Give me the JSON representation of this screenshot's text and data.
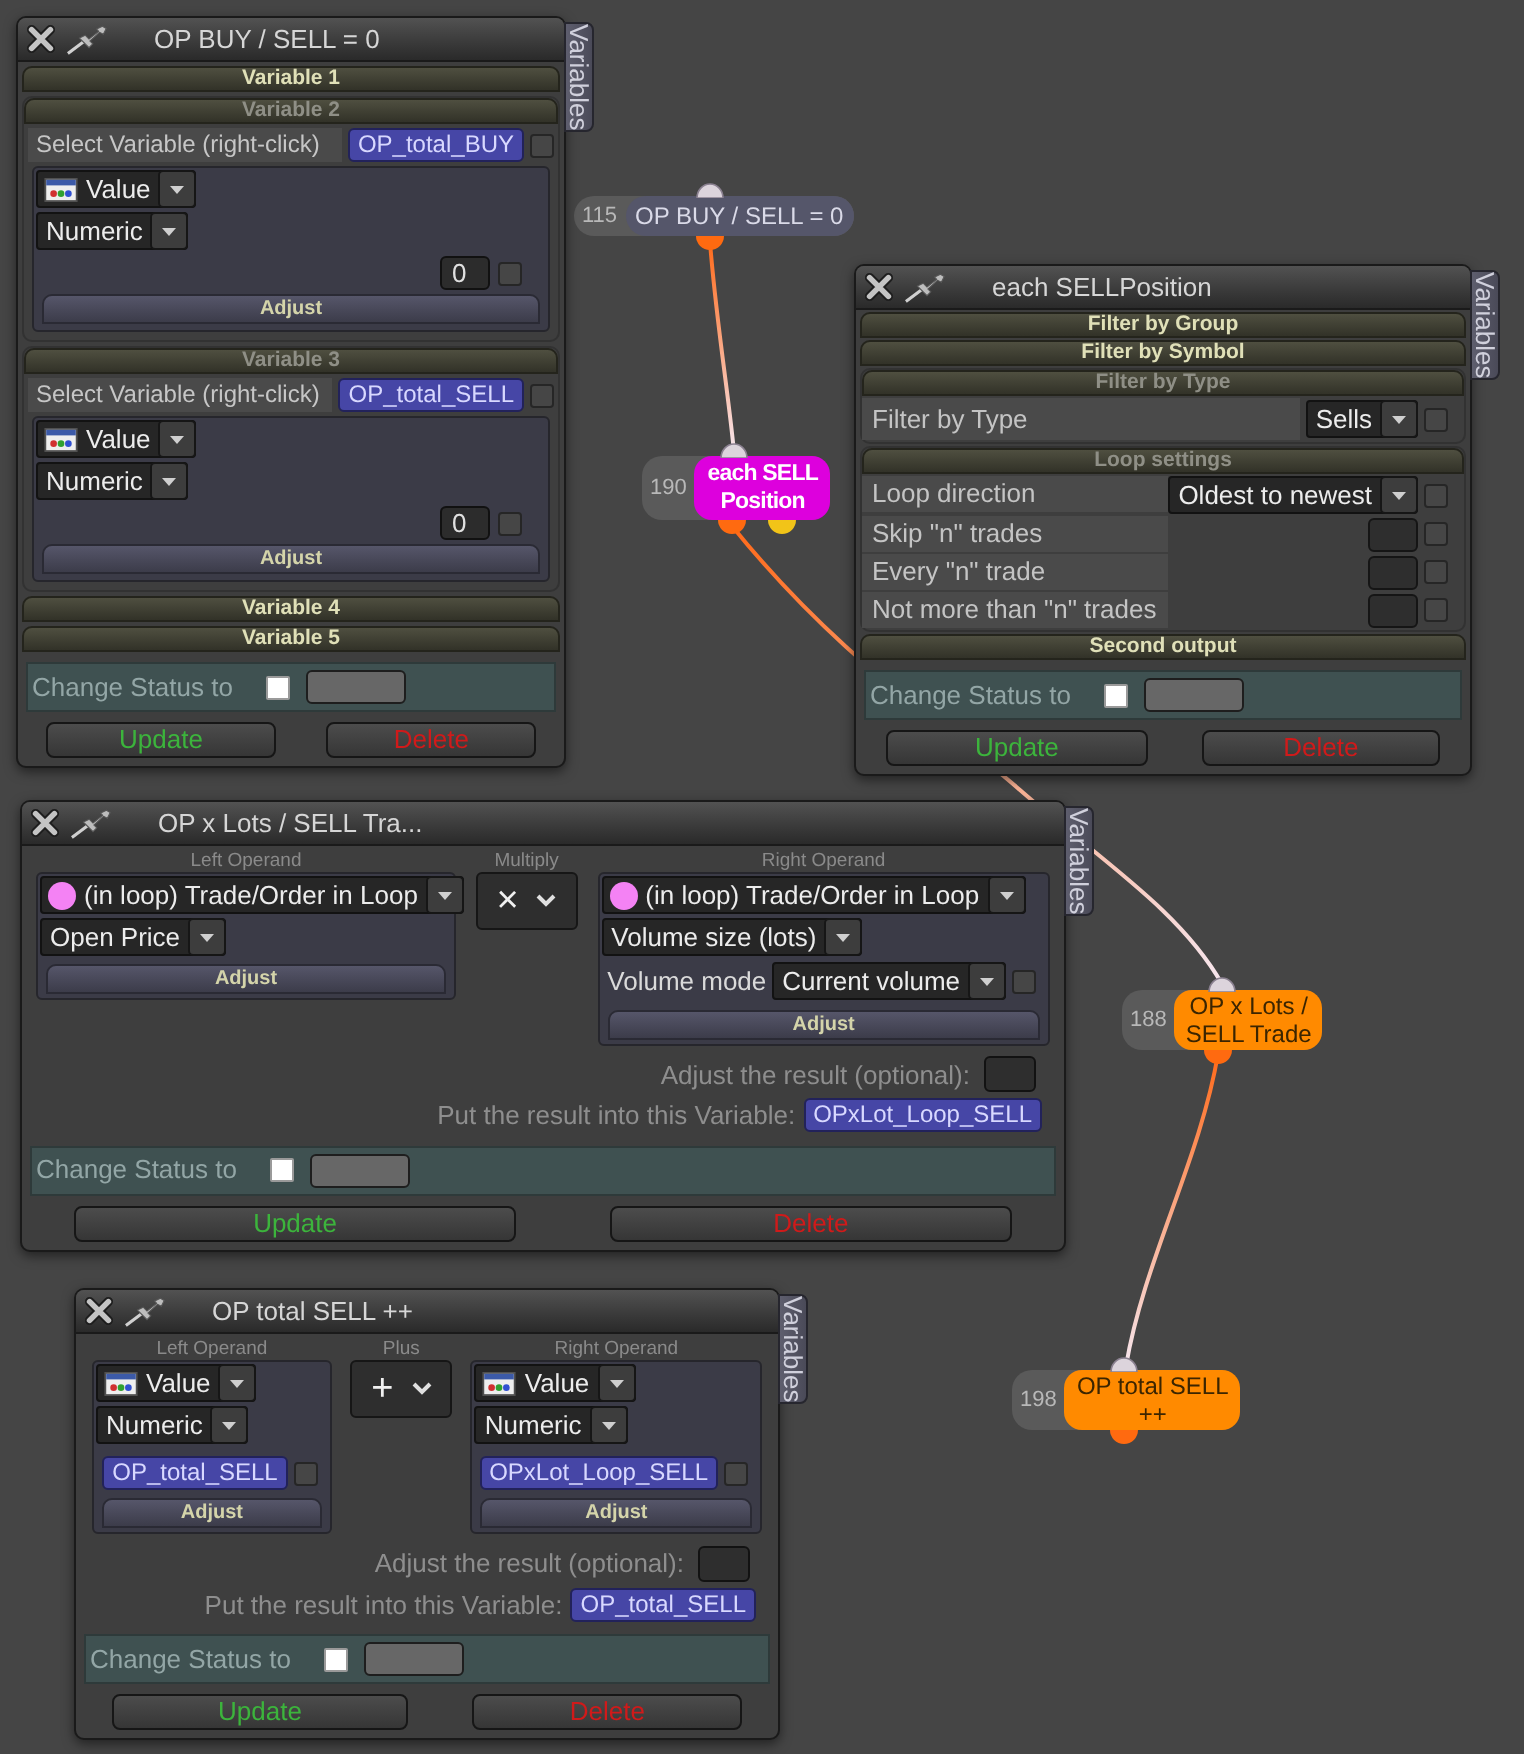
{
  "panels": [
    {
      "kind": "variables",
      "title": "OP BUY / SELL = 0",
      "side_tab": "Variables",
      "sections": [
        {
          "title": "Variable 1",
          "expanded": false
        },
        {
          "title": "Variable 2",
          "expanded": true,
          "select_label": "Select Variable (right-click)",
          "variable": {
            "name": "OP_total_BUY",
            "checked": false
          },
          "source": "Value",
          "format": "Numeric",
          "value": {
            "text": "0",
            "checked": false
          },
          "adjust": "Adjust"
        },
        {
          "title": "Variable 3",
          "expanded": true,
          "select_label": "Select Variable (right-click)",
          "variable": {
            "name": "OP_total_SELL",
            "checked": false
          },
          "source": "Value",
          "format": "Numeric",
          "value": {
            "text": "0",
            "checked": false
          },
          "adjust": "Adjust"
        },
        {
          "title": "Variable 4",
          "expanded": false
        },
        {
          "title": "Variable 5",
          "expanded": false
        }
      ],
      "status": {
        "label": "Change Status to",
        "checked": false
      },
      "buttons": [
        {
          "kind": "update",
          "label": "Update"
        },
        {
          "kind": "delete",
          "label": "Delete"
        }
      ]
    },
    {
      "kind": "loop",
      "title": "each SELLPosition",
      "side_tab": "Variables",
      "sections": [
        {
          "title": "Filter by Group",
          "expanded": false
        },
        {
          "title": "Filter by Symbol",
          "expanded": false
        },
        {
          "title": "Filter by Type",
          "expanded": true,
          "rows": [
            {
              "kind": "select",
              "label": "Filter by Type",
              "value": "Sells",
              "checked": false
            }
          ]
        },
        {
          "title": "Loop settings",
          "expanded": true,
          "rows": [
            {
              "kind": "select",
              "label": "Loop direction",
              "value": "Oldest to newest",
              "checked": false
            },
            {
              "kind": "input",
              "label": "Skip \"n\" trades",
              "checked": false
            },
            {
              "kind": "input",
              "label": "Every \"n\" trade",
              "checked": false
            },
            {
              "kind": "input",
              "label": "Not more than \"n\" trades",
              "checked": false
            }
          ]
        },
        {
          "title": "Second output",
          "expanded": false
        }
      ],
      "status": {
        "label": "Change Status to",
        "checked": false
      },
      "buttons": [
        {
          "kind": "update",
          "label": "Update"
        },
        {
          "kind": "delete",
          "label": "Delete"
        }
      ]
    },
    {
      "kind": "operation",
      "title": "OP x Lots / SELL Tra...",
      "side_tab": "Variables",
      "left": {
        "label": "Left Operand",
        "rows": [
          {
            "kind": "loop-source",
            "value": "(in loop) Trade/Order in Loop"
          },
          {
            "kind": "select",
            "value": "Open Price"
          },
          {
            "kind": "adjust",
            "label": "Adjust"
          }
        ]
      },
      "operator": {
        "label": "Multiply",
        "symbol": "×"
      },
      "right": {
        "label": "Right Operand",
        "rows": [
          {
            "kind": "loop-source",
            "value": "(in loop) Trade/Order in Loop"
          },
          {
            "kind": "select",
            "value": "Volume size (lots)"
          },
          {
            "kind": "labeled-select",
            "label": "Volume mode",
            "value": "Current volume",
            "checked": false
          },
          {
            "kind": "adjust",
            "label": "Adjust"
          }
        ]
      },
      "result": {
        "adjust_label": "Adjust the result (optional):",
        "target_label": "Put the result into this Variable:",
        "target": "OPxLot_Loop_SELL"
      },
      "status": {
        "label": "Change Status to",
        "checked": false
      },
      "buttons": [
        {
          "kind": "update",
          "label": "Update"
        },
        {
          "kind": "delete",
          "label": "Delete"
        }
      ]
    },
    {
      "kind": "operation",
      "title": "OP total SELL ++",
      "side_tab": "Variables",
      "left": {
        "label": "Left Operand",
        "rows": [
          {
            "kind": "value-source",
            "value": "Value"
          },
          {
            "kind": "select",
            "value": "Numeric"
          },
          {
            "kind": "variable",
            "value": "OP_total_SELL",
            "checked": false
          },
          {
            "kind": "adjust",
            "label": "Adjust"
          }
        ]
      },
      "operator": {
        "label": "Plus",
        "symbol": "+"
      },
      "right": {
        "label": "Right Operand",
        "rows": [
          {
            "kind": "value-source",
            "value": "Value"
          },
          {
            "kind": "select",
            "value": "Numeric"
          },
          {
            "kind": "variable",
            "value": "OPxLot_Loop_SELL",
            "checked": false
          },
          {
            "kind": "adjust",
            "label": "Adjust"
          }
        ]
      },
      "result": {
        "adjust_label": "Adjust the result (optional):",
        "target_label": "Put the result into this Variable:",
        "target": "OP_total_SELL"
      },
      "status": {
        "label": "Change Status to",
        "checked": false
      },
      "buttons": [
        {
          "kind": "update",
          "label": "Update"
        },
        {
          "kind": "delete",
          "label": "Delete"
        }
      ]
    }
  ],
  "nodes": [
    {
      "number": "115",
      "label": "OP BUY / SELL = 0",
      "kind": "condition",
      "color": "#55566a",
      "outputs": [
        {
          "color": "#ff6a10"
        }
      ]
    },
    {
      "number": "190",
      "label": "each SELL Position",
      "kind": "loop",
      "color": "#dd00dd",
      "outputs": [
        {
          "color": "#ff6a10"
        },
        {
          "color": "#f2c418"
        }
      ]
    },
    {
      "number": "188",
      "label": "OP x Lots / SELL Trade",
      "kind": "action",
      "color": "#ff8a00",
      "outputs": [
        {
          "color": "#ff6a10"
        }
      ]
    },
    {
      "number": "198",
      "label": "OP total SELL ++",
      "kind": "action",
      "color": "#ff8a00",
      "outputs": [
        {
          "color": "#ff6a10"
        }
      ]
    }
  ]
}
